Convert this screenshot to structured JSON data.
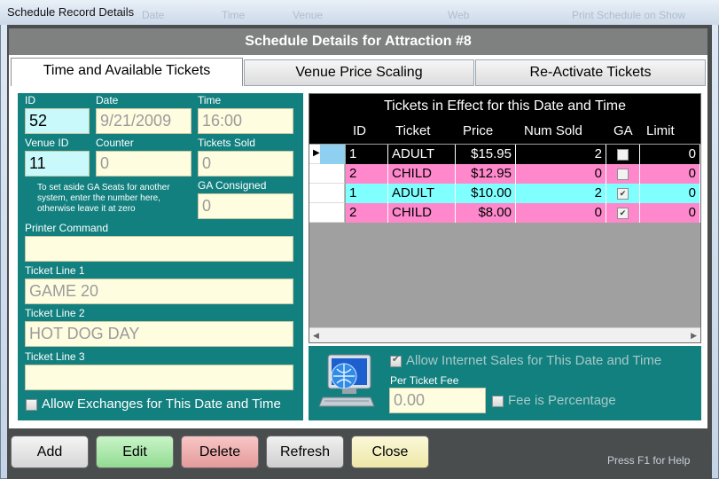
{
  "window": {
    "title": "Schedule Record Details"
  },
  "ghost_text": {
    "a": "Date",
    "b": "Time",
    "c": "Venue",
    "d": "Web",
    "e": "Print Schedule on Show"
  },
  "header": {
    "title": "Schedule Details for Attraction #8"
  },
  "tabs": [
    {
      "label": "Time and Available Tickets",
      "active": true
    },
    {
      "label": "Venue Price Scaling",
      "active": false
    },
    {
      "label": "Re-Activate Tickets",
      "active": false
    }
  ],
  "form": {
    "id_label": "ID",
    "id_value": "52",
    "date_label": "Date",
    "date_value": "9/21/2009",
    "time_label": "Time",
    "time_value": "16:00",
    "venue_id_label": "Venue ID",
    "venue_id_value": "11",
    "counter_label": "Counter",
    "counter_value": "0",
    "tickets_sold_label": "Tickets Sold",
    "tickets_sold_value": "0",
    "ga_note": "To set aside GA Seats for another system, enter the number here, otherwise leave it at zero",
    "ga_consigned_label": "GA Consigned",
    "ga_consigned_value": "0",
    "printer_command_label": "Printer Command",
    "printer_command_value": "",
    "ticket_line1_label": "Ticket Line 1",
    "ticket_line1_value": "GAME 20",
    "ticket_line2_label": "Ticket Line 2",
    "ticket_line2_value": "HOT DOG DAY",
    "ticket_line3_label": "Ticket Line 3",
    "ticket_line3_value": "",
    "allow_exchanges_label": "Allow Exchanges for This Date and Time",
    "allow_exchanges_checked": false
  },
  "grid": {
    "title": "Tickets in Effect for this Date and Time",
    "columns": [
      "ID",
      "Ticket",
      "Price",
      "Num Sold",
      "GA",
      "Limit"
    ],
    "rows": [
      {
        "id": "1",
        "ticket": "ADULT",
        "price": "$15.95",
        "num_sold": "2",
        "ga": false,
        "limit": "0",
        "color": "#000000",
        "text_color": "#ffffff",
        "selected": true
      },
      {
        "id": "2",
        "ticket": "CHILD",
        "price": "$12.95",
        "num_sold": "0",
        "ga": false,
        "limit": "0",
        "color": "#ff88cc",
        "text_color": "#000000",
        "selected": false
      },
      {
        "id": "1",
        "ticket": "ADULT",
        "price": "$10.00",
        "num_sold": "2",
        "ga": true,
        "limit": "0",
        "color": "#80ffff",
        "text_color": "#000000",
        "selected": false
      },
      {
        "id": "2",
        "ticket": "CHILD",
        "price": "$8.00",
        "num_sold": "0",
        "ga": true,
        "limit": "0",
        "color": "#ff88cc",
        "text_color": "#000000",
        "selected": false
      }
    ]
  },
  "internet": {
    "allow_label": "Allow Internet Sales for This Date and Time",
    "allow_checked": true,
    "fee_label": "Per Ticket Fee",
    "fee_value": "0.00",
    "fee_pct_label": "Fee is Percentage",
    "fee_pct_checked": false
  },
  "buttons": {
    "add": "Add",
    "edit": "Edit",
    "delete": "Delete",
    "refresh": "Refresh",
    "close": "Close"
  },
  "colors": {
    "add": "#e8e8e8",
    "edit": "#a8e8a8",
    "delete": "#f0a8a8",
    "refresh": "#e0e0e0",
    "close": "#f7f3c0",
    "panel": "#12807f",
    "field": "#fffde0",
    "field_blue": "#c9f9fb"
  },
  "status": {
    "help": "Press F1 for Help"
  }
}
